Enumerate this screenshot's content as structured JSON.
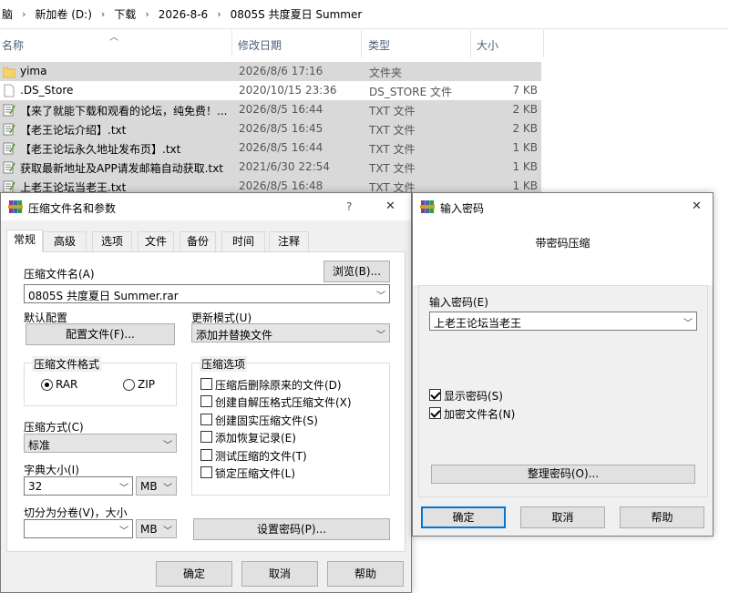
{
  "explorer": {
    "breadcrumb": [
      "脑",
      "新加卷 (D:)",
      "下载",
      "2026-8-6",
      "0805S 共度夏日 Summer"
    ],
    "columns": {
      "name": "名称",
      "date": "修改日期",
      "type": "类型",
      "size": "大小"
    },
    "files": [
      {
        "name": "yima",
        "date": "2026/8/6 17:16",
        "type": "文件夹",
        "size": "",
        "icon": "folder-icon"
      },
      {
        "name": ".DS_Store",
        "date": "2020/10/15 23:36",
        "type": "DS_STORE 文件",
        "size": "7 KB",
        "icon": "blank-file-icon"
      },
      {
        "name": "【来了就能下载和观看的论坛，纯免费！...",
        "date": "2026/8/5 16:44",
        "type": "TXT 文件",
        "size": "2 KB",
        "icon": "text-file-icon"
      },
      {
        "name": "【老王论坛介绍】.txt",
        "date": "2026/8/5 16:45",
        "type": "TXT 文件",
        "size": "2 KB",
        "icon": "text-file-icon"
      },
      {
        "name": "【老王论坛永久地址发布页】.txt",
        "date": "2026/8/5 16:44",
        "type": "TXT 文件",
        "size": "1 KB",
        "icon": "text-file-icon"
      },
      {
        "name": "获取最新地址及APP请发邮箱自动获取.txt",
        "date": "2021/6/30 22:54",
        "type": "TXT 文件",
        "size": "1 KB",
        "icon": "text-file-icon"
      },
      {
        "name": "上老王论坛当老王.txt",
        "date": "2026/8/5 16:48",
        "type": "TXT 文件",
        "size": "1 KB",
        "icon": "text-file-icon"
      }
    ]
  },
  "archive_dialog": {
    "title": "压缩文件名和参数",
    "help_glyph": "?",
    "close_glyph": "✕",
    "tabs": [
      "常规",
      "高级",
      "选项",
      "文件",
      "备份",
      "时间",
      "注释"
    ],
    "archive_name_label": "压缩文件名(A)",
    "browse_button": "浏览(B)...",
    "archive_name_value": "0805S 共度夏日 Summer.rar",
    "default_profile_label": "默认配置",
    "profiles_button": "配置文件(F)...",
    "update_mode_label": "更新模式(U)",
    "update_mode_value": "添加并替换文件",
    "format_group_label": "压缩文件格式",
    "format_rar": "RAR",
    "format_zip": "ZIP",
    "options_group_label": "压缩选项",
    "options": [
      {
        "label": "压缩后删除原来的文件(D)",
        "checked": false
      },
      {
        "label": "创建自解压格式压缩文件(X)",
        "checked": false
      },
      {
        "label": "创建固实压缩文件(S)",
        "checked": false
      },
      {
        "label": "添加恢复记录(E)",
        "checked": false
      },
      {
        "label": "测试压缩的文件(T)",
        "checked": false
      },
      {
        "label": "锁定压缩文件(L)",
        "checked": false
      }
    ],
    "method_label": "压缩方式(C)",
    "method_value": "标准",
    "dict_label": "字典大小(I)",
    "dict_value": "32",
    "dict_unit": "MB",
    "split_label": "切分为分卷(V)，大小",
    "split_value": "",
    "split_unit": "MB",
    "set_password_button": "设置密码(P)...",
    "ok_button": "确定",
    "cancel_button": "取消",
    "help_button": "帮助"
  },
  "password_dialog": {
    "title": "输入密码",
    "close_glyph": "✕",
    "header": "带密码压缩",
    "enter_password_label": "输入密码(E)",
    "password_value": "上老王论坛当老王",
    "show_password_label": "显示密码(S)",
    "show_password_checked": true,
    "encrypt_names_label": "加密文件名(N)",
    "encrypt_names_checked": true,
    "organize_button": "整理密码(O)...",
    "ok_button": "确定",
    "cancel_button": "取消",
    "help_button": "帮助"
  },
  "colors": {
    "selection_gray": "#d9d9d9",
    "dialog_bg": "#f0f0f0",
    "accent": "#0078d7",
    "folder": "#f7d26b"
  }
}
